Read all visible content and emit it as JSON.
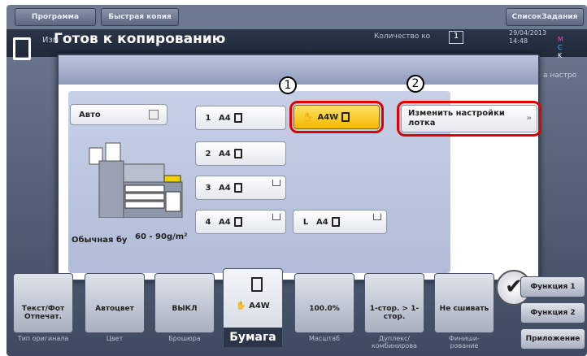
{
  "top_bar": {
    "program": "Программа",
    "quick_copy": "Быстрая копия",
    "job_list": "СписокЗадания"
  },
  "status": {
    "title": "Готов к копированию",
    "subtitle": "Изм",
    "copies_label": "Количество ко",
    "copies_value": "1",
    "datetime": "29/04/2013",
    "time": "14:48",
    "toner": [
      "M",
      "C",
      "K"
    ],
    "right_fragment": "а настро"
  },
  "dialog": {
    "auto_label": "Авто",
    "trays": [
      {
        "num": "1",
        "size": "A4"
      },
      {
        "num": "2",
        "size": "A4"
      },
      {
        "num": "3",
        "size": "A4"
      },
      {
        "num": "4",
        "size": "A4"
      }
    ],
    "large_tray": {
      "num": "L",
      "size": "A4"
    },
    "manual_tray": "A4W",
    "change_settings": "Изменить настройки лотка",
    "paper_type": "Обычная бу",
    "paper_weight": "60 - 90g/m²",
    "callout_1": "1",
    "callout_2": "2"
  },
  "functions": [
    {
      "value": "Текст/Фот Отпечат.",
      "caption": "Тип оригинала"
    },
    {
      "value": "Автоцвет",
      "caption": "Цвет"
    },
    {
      "value": "ВЫКЛ",
      "caption": "Брошюра"
    },
    {
      "value": "A4W",
      "caption": "Бумага"
    },
    {
      "value": "100.0%",
      "caption": "Масштаб"
    },
    {
      "value": "1-стор. > 1-стор.",
      "caption": "Дуплекс/ комбинирова"
    },
    {
      "value": "Не сшивать",
      "caption": "Финиши- рование"
    }
  ],
  "side_buttons": {
    "func1": "Функция 1",
    "func2": "Функция 2",
    "app": "Приложение"
  },
  "colors": {
    "highlight": "#e00000",
    "manual_tray": "#f4b800"
  }
}
